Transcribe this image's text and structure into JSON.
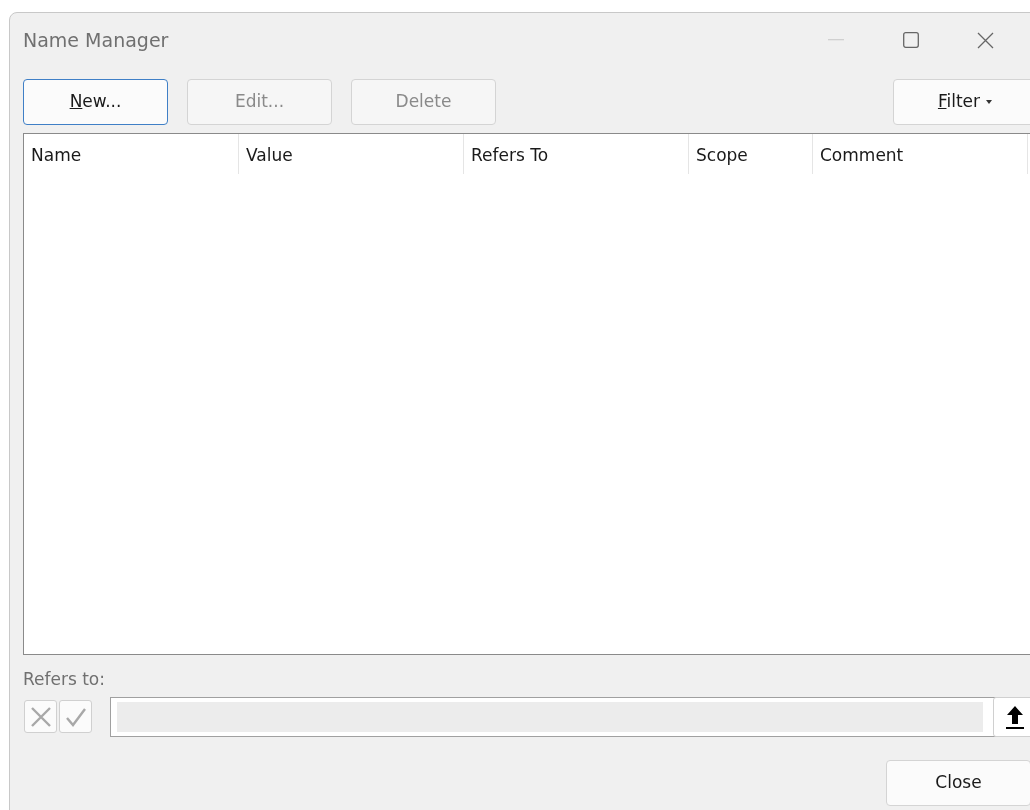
{
  "window": {
    "title": "Name Manager"
  },
  "toolbar": [
    {
      "mnemonic": "N",
      "label": "ew...",
      "disabled": false,
      "focused": true
    },
    {
      "label": "Edit...",
      "disabled": true,
      "focused": false
    },
    {
      "label": "Delete",
      "disabled": true,
      "focused": false
    }
  ],
  "filter_button": {
    "mnemonic": "F",
    "label": "ilter"
  },
  "table": {
    "columns": [
      "Name",
      "Value",
      "Refers To",
      "Scope",
      "Comment"
    ]
  },
  "refers_to": {
    "label": "Refers to:",
    "cancel_disabled": true,
    "confirm_disabled": true
  },
  "buttons": [
    "Close"
  ]
}
